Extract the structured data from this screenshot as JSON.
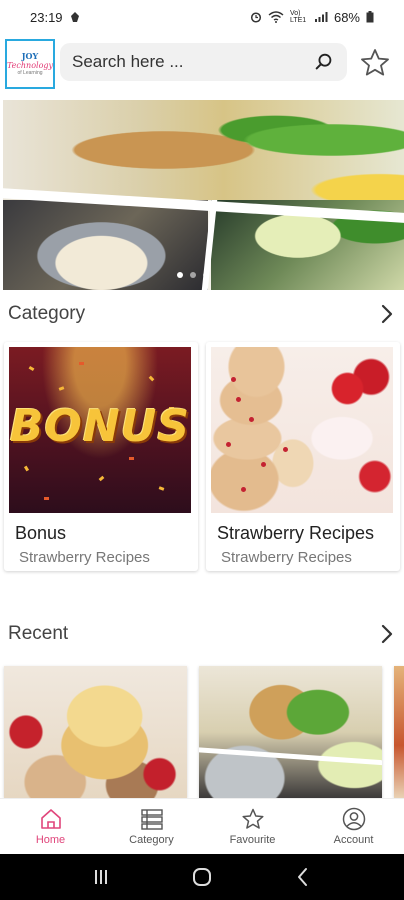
{
  "status_bar": {
    "time": "23:19",
    "battery": "68%",
    "network": "Vo) LTE1"
  },
  "header": {
    "logo_line1": "JOY",
    "logo_line2": "Technology",
    "logo_line3": "of Learning",
    "search_placeholder": "Search here ...",
    "icons": {
      "search": "search-icon",
      "favourite": "star-outline-icon"
    }
  },
  "banner": {
    "slides_count": 3,
    "active_index": 0
  },
  "category": {
    "title": "Category",
    "items": [
      {
        "title": "Bonus",
        "subtitle": "Strawberry Recipes",
        "image_text": "BONUS"
      },
      {
        "title": "Strawberry Recipes",
        "subtitle": "Strawberry Recipes"
      }
    ]
  },
  "recent": {
    "title": "Recent"
  },
  "bottom_nav": {
    "items": [
      {
        "label": "Home",
        "icon": "home-icon",
        "active": true
      },
      {
        "label": "Category",
        "icon": "list-icon",
        "active": false
      },
      {
        "label": "Favourite",
        "icon": "star-icon",
        "active": false
      },
      {
        "label": "Account",
        "icon": "account-icon",
        "active": false
      }
    ]
  },
  "colors": {
    "accent": "#e0457b",
    "logo_border": "#29a9df"
  }
}
